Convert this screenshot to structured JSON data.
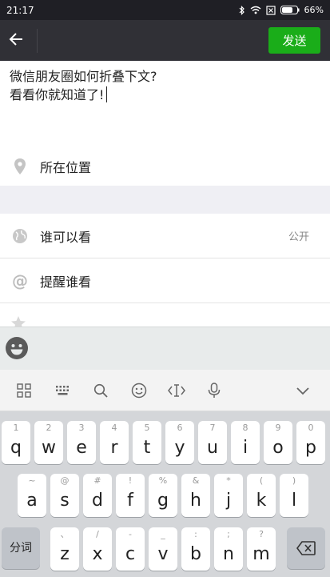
{
  "status_bar": {
    "time": "21:17",
    "battery": "66%"
  },
  "app_bar": {
    "send_label": "发送"
  },
  "composer": {
    "line1": "微信朋友圈如何折叠下文?",
    "line2": "看看你就知道了!"
  },
  "location": {
    "label": "所在位置"
  },
  "visibility": {
    "label": "谁可以看",
    "value": "公开"
  },
  "remind": {
    "label": "提醒谁看"
  },
  "keyboard": {
    "row1": [
      {
        "hint": "1",
        "key": "q"
      },
      {
        "hint": "2",
        "key": "w"
      },
      {
        "hint": "3",
        "key": "e"
      },
      {
        "hint": "4",
        "key": "r"
      },
      {
        "hint": "5",
        "key": "t"
      },
      {
        "hint": "6",
        "key": "y"
      },
      {
        "hint": "7",
        "key": "u"
      },
      {
        "hint": "8",
        "key": "i"
      },
      {
        "hint": "9",
        "key": "o"
      },
      {
        "hint": "0",
        "key": "p"
      }
    ],
    "row2": [
      {
        "hint": "~",
        "key": "a"
      },
      {
        "hint": "@",
        "key": "s"
      },
      {
        "hint": "#",
        "key": "d"
      },
      {
        "hint": "!",
        "key": "f"
      },
      {
        "hint": "%",
        "key": "g"
      },
      {
        "hint": "&",
        "key": "h"
      },
      {
        "hint": "*",
        "key": "j"
      },
      {
        "hint": "(",
        "key": "k"
      },
      {
        "hint": ")",
        "key": "l"
      }
    ],
    "row3": [
      {
        "hint": "、",
        "key": "z"
      },
      {
        "hint": "/",
        "key": "x"
      },
      {
        "hint": "-",
        "key": "c"
      },
      {
        "hint": "_",
        "key": "v"
      },
      {
        "hint": ":",
        "key": "b"
      },
      {
        "hint": ";",
        "key": "n"
      },
      {
        "hint": "?",
        "key": "m"
      }
    ],
    "segment_label": "分词"
  },
  "colors": {
    "status_bar": "#1f1f25",
    "app_bar": "#303036",
    "send_button": "#1aad19",
    "keyboard_bg": "#d4d6d9"
  },
  "icons": [
    "bluetooth-icon",
    "wifi-icon",
    "sim-icon",
    "battery-icon",
    "back-arrow-icon",
    "location-pin-icon",
    "globe-icon",
    "at-icon",
    "star-icon",
    "emoji-icon",
    "grid-icon",
    "keyboard-icon",
    "search-icon",
    "smiley-icon",
    "cursor-icon",
    "microphone-icon",
    "chevron-down-icon",
    "backspace-icon"
  ]
}
